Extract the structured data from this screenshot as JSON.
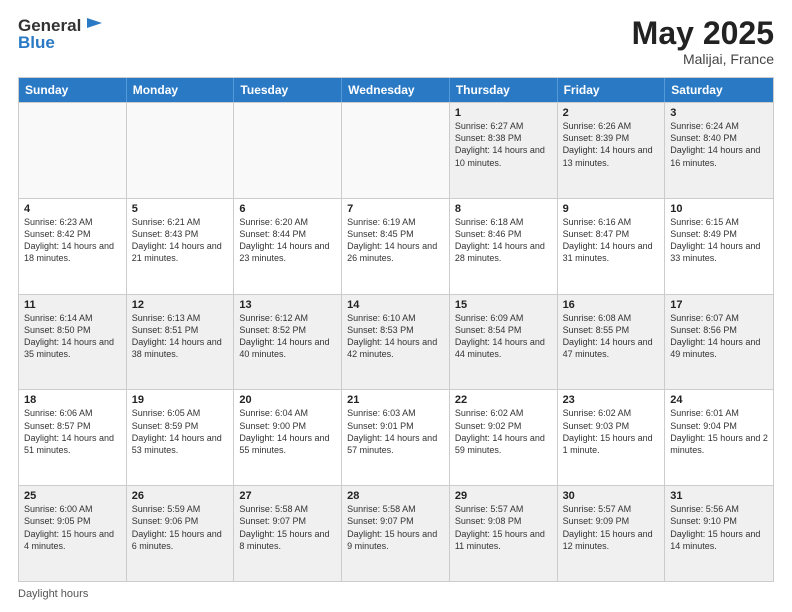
{
  "logo": {
    "general": "General",
    "blue": "Blue"
  },
  "title": {
    "month_year": "May 2025",
    "location": "Malijai, France"
  },
  "header_days": [
    "Sunday",
    "Monday",
    "Tuesday",
    "Wednesday",
    "Thursday",
    "Friday",
    "Saturday"
  ],
  "weeks": [
    [
      {
        "day": "",
        "info": ""
      },
      {
        "day": "",
        "info": ""
      },
      {
        "day": "",
        "info": ""
      },
      {
        "day": "",
        "info": ""
      },
      {
        "day": "1",
        "info": "Sunrise: 6:27 AM\nSunset: 8:38 PM\nDaylight: 14 hours and 10 minutes."
      },
      {
        "day": "2",
        "info": "Sunrise: 6:26 AM\nSunset: 8:39 PM\nDaylight: 14 hours and 13 minutes."
      },
      {
        "day": "3",
        "info": "Sunrise: 6:24 AM\nSunset: 8:40 PM\nDaylight: 14 hours and 16 minutes."
      }
    ],
    [
      {
        "day": "4",
        "info": "Sunrise: 6:23 AM\nSunset: 8:42 PM\nDaylight: 14 hours and 18 minutes."
      },
      {
        "day": "5",
        "info": "Sunrise: 6:21 AM\nSunset: 8:43 PM\nDaylight: 14 hours and 21 minutes."
      },
      {
        "day": "6",
        "info": "Sunrise: 6:20 AM\nSunset: 8:44 PM\nDaylight: 14 hours and 23 minutes."
      },
      {
        "day": "7",
        "info": "Sunrise: 6:19 AM\nSunset: 8:45 PM\nDaylight: 14 hours and 26 minutes."
      },
      {
        "day": "8",
        "info": "Sunrise: 6:18 AM\nSunset: 8:46 PM\nDaylight: 14 hours and 28 minutes."
      },
      {
        "day": "9",
        "info": "Sunrise: 6:16 AM\nSunset: 8:47 PM\nDaylight: 14 hours and 31 minutes."
      },
      {
        "day": "10",
        "info": "Sunrise: 6:15 AM\nSunset: 8:49 PM\nDaylight: 14 hours and 33 minutes."
      }
    ],
    [
      {
        "day": "11",
        "info": "Sunrise: 6:14 AM\nSunset: 8:50 PM\nDaylight: 14 hours and 35 minutes."
      },
      {
        "day": "12",
        "info": "Sunrise: 6:13 AM\nSunset: 8:51 PM\nDaylight: 14 hours and 38 minutes."
      },
      {
        "day": "13",
        "info": "Sunrise: 6:12 AM\nSunset: 8:52 PM\nDaylight: 14 hours and 40 minutes."
      },
      {
        "day": "14",
        "info": "Sunrise: 6:10 AM\nSunset: 8:53 PM\nDaylight: 14 hours and 42 minutes."
      },
      {
        "day": "15",
        "info": "Sunrise: 6:09 AM\nSunset: 8:54 PM\nDaylight: 14 hours and 44 minutes."
      },
      {
        "day": "16",
        "info": "Sunrise: 6:08 AM\nSunset: 8:55 PM\nDaylight: 14 hours and 47 minutes."
      },
      {
        "day": "17",
        "info": "Sunrise: 6:07 AM\nSunset: 8:56 PM\nDaylight: 14 hours and 49 minutes."
      }
    ],
    [
      {
        "day": "18",
        "info": "Sunrise: 6:06 AM\nSunset: 8:57 PM\nDaylight: 14 hours and 51 minutes."
      },
      {
        "day": "19",
        "info": "Sunrise: 6:05 AM\nSunset: 8:59 PM\nDaylight: 14 hours and 53 minutes."
      },
      {
        "day": "20",
        "info": "Sunrise: 6:04 AM\nSunset: 9:00 PM\nDaylight: 14 hours and 55 minutes."
      },
      {
        "day": "21",
        "info": "Sunrise: 6:03 AM\nSunset: 9:01 PM\nDaylight: 14 hours and 57 minutes."
      },
      {
        "day": "22",
        "info": "Sunrise: 6:02 AM\nSunset: 9:02 PM\nDaylight: 14 hours and 59 minutes."
      },
      {
        "day": "23",
        "info": "Sunrise: 6:02 AM\nSunset: 9:03 PM\nDaylight: 15 hours and 1 minute."
      },
      {
        "day": "24",
        "info": "Sunrise: 6:01 AM\nSunset: 9:04 PM\nDaylight: 15 hours and 2 minutes."
      }
    ],
    [
      {
        "day": "25",
        "info": "Sunrise: 6:00 AM\nSunset: 9:05 PM\nDaylight: 15 hours and 4 minutes."
      },
      {
        "day": "26",
        "info": "Sunrise: 5:59 AM\nSunset: 9:06 PM\nDaylight: 15 hours and 6 minutes."
      },
      {
        "day": "27",
        "info": "Sunrise: 5:58 AM\nSunset: 9:07 PM\nDaylight: 15 hours and 8 minutes."
      },
      {
        "day": "28",
        "info": "Sunrise: 5:58 AM\nSunset: 9:07 PM\nDaylight: 15 hours and 9 minutes."
      },
      {
        "day": "29",
        "info": "Sunrise: 5:57 AM\nSunset: 9:08 PM\nDaylight: 15 hours and 11 minutes."
      },
      {
        "day": "30",
        "info": "Sunrise: 5:57 AM\nSunset: 9:09 PM\nDaylight: 15 hours and 12 minutes."
      },
      {
        "day": "31",
        "info": "Sunrise: 5:56 AM\nSunset: 9:10 PM\nDaylight: 15 hours and 14 minutes."
      }
    ]
  ],
  "footer": {
    "label": "Daylight hours"
  }
}
